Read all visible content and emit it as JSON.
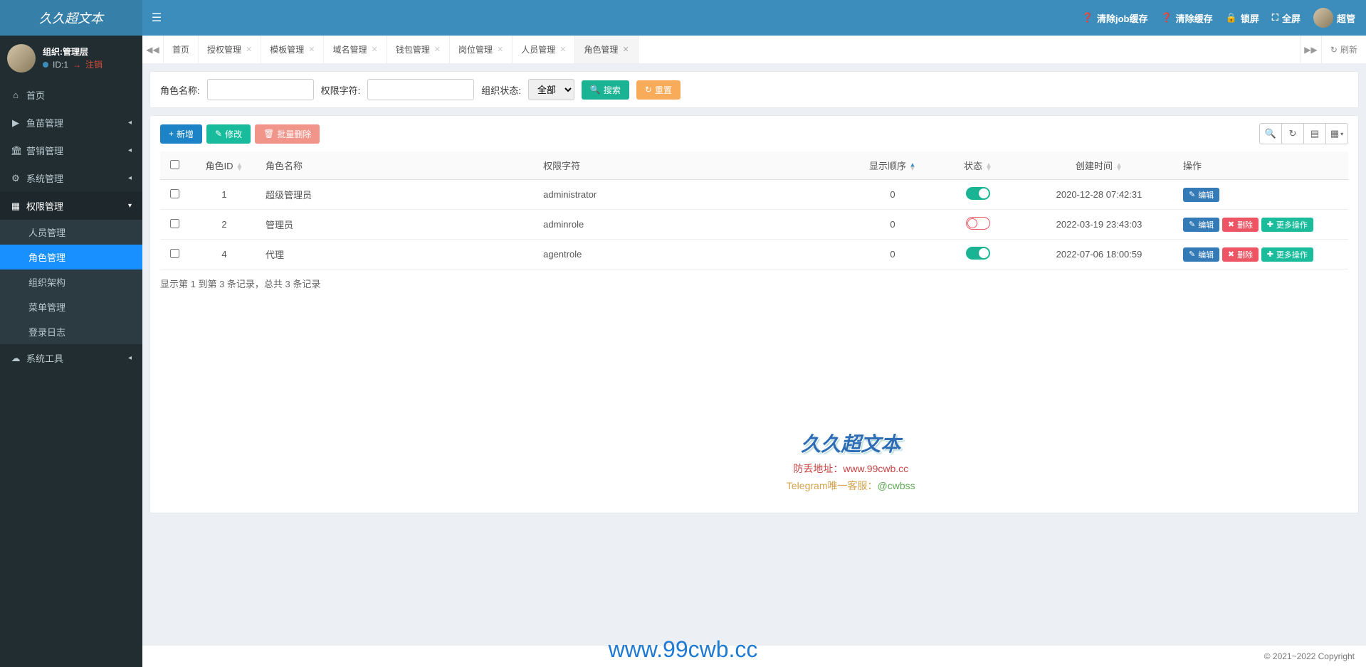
{
  "brand": "久久超文本",
  "header": {
    "clear_job_cache": "清除job缓存",
    "clear_cache": "清除缓存",
    "lock": "锁屏",
    "fullscreen": "全屏",
    "user": "超管"
  },
  "sidebar": {
    "user_org": "组织:管理层",
    "user_id": "ID:1",
    "logout": "注销",
    "items": [
      {
        "icon": "home",
        "label": "首页",
        "expandable": false
      },
      {
        "icon": "play",
        "label": "鱼苗管理",
        "expandable": true
      },
      {
        "icon": "bank",
        "label": "营销管理",
        "expandable": true
      },
      {
        "icon": "gear",
        "label": "系统管理",
        "expandable": true
      },
      {
        "icon": "layout",
        "label": "权限管理",
        "expandable": true,
        "open": true,
        "children": [
          {
            "label": "人员管理"
          },
          {
            "label": "角色管理",
            "active": true
          },
          {
            "label": "组织架构"
          },
          {
            "label": "菜单管理"
          },
          {
            "label": "登录日志"
          }
        ]
      },
      {
        "icon": "cloud",
        "label": "系统工具",
        "expandable": true
      }
    ]
  },
  "tabs": {
    "items": [
      {
        "label": "首页",
        "closable": false
      },
      {
        "label": "授权管理",
        "closable": true
      },
      {
        "label": "模板管理",
        "closable": true
      },
      {
        "label": "域名管理",
        "closable": true
      },
      {
        "label": "钱包管理",
        "closable": true
      },
      {
        "label": "岗位管理",
        "closable": true
      },
      {
        "label": "人员管理",
        "closable": true
      },
      {
        "label": "角色管理",
        "closable": true,
        "active": true
      }
    ],
    "refresh": "刷新"
  },
  "filters": {
    "role_name_label": "角色名称:",
    "perm_char_label": "权限字符:",
    "org_status_label": "组织状态:",
    "org_status_value": "全部",
    "search": "搜索",
    "reset": "重置"
  },
  "toolbar": {
    "add": "新增",
    "edit": "修改",
    "batch_delete": "批量删除"
  },
  "table": {
    "cols": {
      "role_id": "角色ID",
      "role_name": "角色名称",
      "perm": "权限字符",
      "order": "显示顺序",
      "status": "状态",
      "created": "创建时间",
      "action": "操作"
    },
    "rows": [
      {
        "id": "1",
        "name": "超级管理员",
        "perm": "administrator",
        "order": "0",
        "status": "on",
        "created": "2020-12-28 07:42:31",
        "actions": [
          "edit"
        ]
      },
      {
        "id": "2",
        "name": "管理员",
        "perm": "adminrole",
        "order": "0",
        "status": "off",
        "created": "2022-03-19 23:43:03",
        "actions": [
          "edit",
          "delete",
          "more"
        ]
      },
      {
        "id": "4",
        "name": "代理",
        "perm": "agentrole",
        "order": "0",
        "status": "on",
        "created": "2022-07-06 18:00:59",
        "actions": [
          "edit",
          "delete",
          "more"
        ]
      }
    ],
    "action_labels": {
      "edit": "编辑",
      "delete": "删除",
      "more": "更多操作"
    },
    "footer": "显示第 1 到第 3 条记录，总共 3 条记录"
  },
  "watermark": {
    "title": "久久超文本",
    "line1_a": "防丢地址：",
    "line1_b": "www.99cwb.cc",
    "line2_a": "Telegram唯一客服：",
    "line2_b": "@cwbss",
    "bigurl": "www.99cwb.cc"
  },
  "copyright": "© 2021~2022 Copyright"
}
